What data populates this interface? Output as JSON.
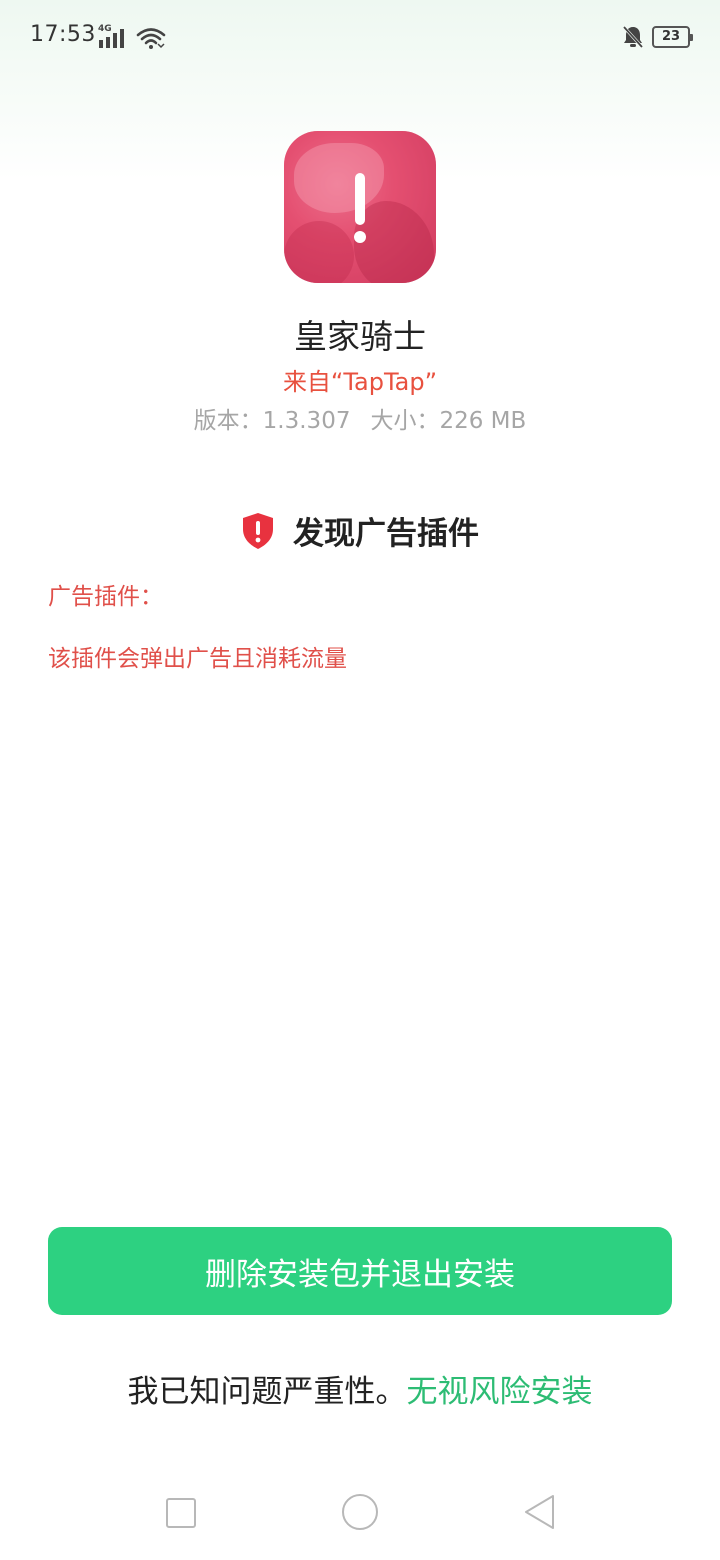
{
  "status_bar": {
    "time": "17:53",
    "network": "4G",
    "battery": "23",
    "icons": [
      "signal-icon",
      "wifi-icon",
      "mute-icon",
      "battery-icon"
    ]
  },
  "app": {
    "name": "皇家骑士",
    "source": "来自“TapTap”",
    "version": "版本：1.3.307",
    "size": "大小：226 MB",
    "icon": "app-icon-warning"
  },
  "warning": {
    "title": "发现广告插件",
    "plugin_label": "广告插件：",
    "plugin_description": "该插件会弹出广告且消耗流量",
    "icon": "shield-alert-icon"
  },
  "actions": {
    "delete_exit_label": "删除安装包并退出安装",
    "ignore_prefix": "我已知问题严重性。",
    "ignore_link_label": "无视风险安装"
  },
  "nav_bar": {
    "items": [
      "recent-apps",
      "home",
      "back"
    ]
  },
  "colors": {
    "accent_green": "#2dd181",
    "link_green": "#2dbc74",
    "warning_red": "#e0504a",
    "source_red": "#e8513f",
    "shield_red": "#e8323f"
  }
}
